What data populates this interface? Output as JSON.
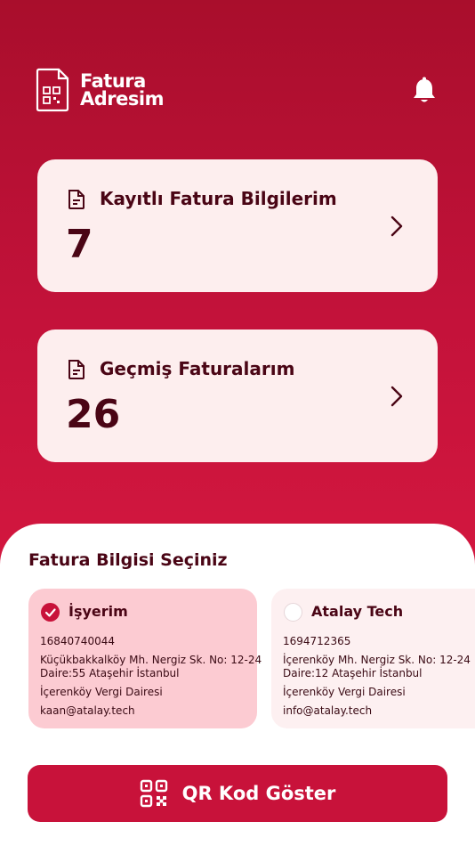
{
  "brand": {
    "line1": "Fatura",
    "line2": "Adresim"
  },
  "icons": {
    "bell": "bell-icon",
    "document": "document-icon",
    "chevron": "chevron-right-icon",
    "check": "check-icon",
    "qr": "qr-code-icon"
  },
  "colors": {
    "primary": "#c8123a",
    "primary_dark": "#a90e2c",
    "card_bg": "#fdeeee",
    "selected_card_bg": "#fccbd2",
    "text_dark": "#4a0515"
  },
  "stats": [
    {
      "title": "Kayıtlı Fatura Bilgilerim",
      "value": "7"
    },
    {
      "title": "Geçmiş Faturalarım",
      "value": "26"
    }
  ],
  "section_title": "Fatura Bilgisi Seçiniz",
  "addresses": [
    {
      "selected": true,
      "name": "İşyerim",
      "tax_number": "16840740044",
      "address_line1": "Küçükbakkalköy Mh. Nergiz Sk. No: 12-24",
      "address_line2": "Daire:55 Ataşehir İstanbul",
      "tax_office": "İçerenköy Vergi Dairesi",
      "email": "kaan@atalay.tech"
    },
    {
      "selected": false,
      "name": "Atalay Tech",
      "tax_number": "1694712365",
      "address_line1": "İçerenköy Mh. Nergiz Sk. No: 12-24",
      "address_line2": "Daire:12 Ataşehir İstanbul",
      "tax_office": "İçerenköy Vergi Dairesi",
      "email": "info@atalay.tech"
    }
  ],
  "qr_button": {
    "label": "QR Kod Göster"
  }
}
